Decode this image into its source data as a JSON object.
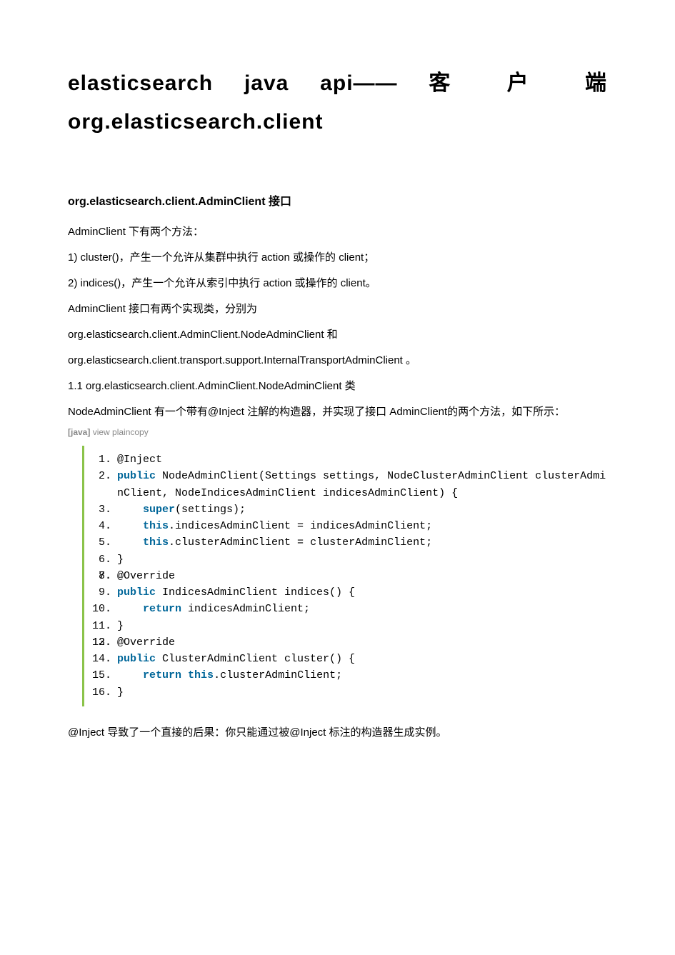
{
  "title": "elasticsearch java api—— 客 户 端 org.elasticsearch.client",
  "section": "org.elasticsearch.client.AdminClient 接口",
  "paras": [
    "AdminClient 下有两个方法：",
    "1) cluster()，产生一个允许从集群中执行 action 或操作的 client；",
    "2) indices()，产生一个允许从索引中执行 action 或操作的 client。",
    "AdminClient 接口有两个实现类，分别为",
    "org.elasticsearch.client.AdminClient.NodeAdminClient 和",
    "org.elasticsearch.client.transport.support.InternalTransportAdminClient 。",
    "1.1 org.elasticsearch.client.AdminClient.NodeAdminClient 类",
    "NodeAdminClient 有一个带有@Inject 注解的构造器，并实现了接口 AdminClient的两个方法，如下所示："
  ],
  "codeMeta": {
    "lang": "[java]",
    "links": " view plaincopy"
  },
  "code": {
    "l1_anno": "@Inject",
    "l2_kw": "public",
    "l2_rest": " NodeAdminClient(Settings settings, NodeClusterAdminClient clusterAdminClient, NodeIndicesAdminClient indicesAdminClient) {",
    "l3_kw": "super",
    "l3_rest": "(settings);",
    "l4_kw": "this",
    "l4_rest": ".indicesAdminClient = indicesAdminClient;",
    "l5_kw": "this",
    "l5_rest": ".clusterAdminClient = clusterAdminClient;",
    "l6": "}",
    "l7": "",
    "l8_anno": "@Override",
    "l9_kw": "public",
    "l9_rest": " IndicesAdminClient indices() {",
    "l10_kw": "return",
    "l10_rest": " indicesAdminClient;",
    "l11": "}",
    "l12": "",
    "l13_anno": "@Override",
    "l14_kw": "public",
    "l14_rest": " ClusterAdminClient cluster() {",
    "l15_kw1": "return",
    "l15_sp": " ",
    "l15_kw2": "this",
    "l15_rest": ".clusterAdminClient;",
    "l16": "}"
  },
  "footer": "@Inject 导致了一个直接的后果：你只能通过被@Inject 标注的构造器生成实例。"
}
